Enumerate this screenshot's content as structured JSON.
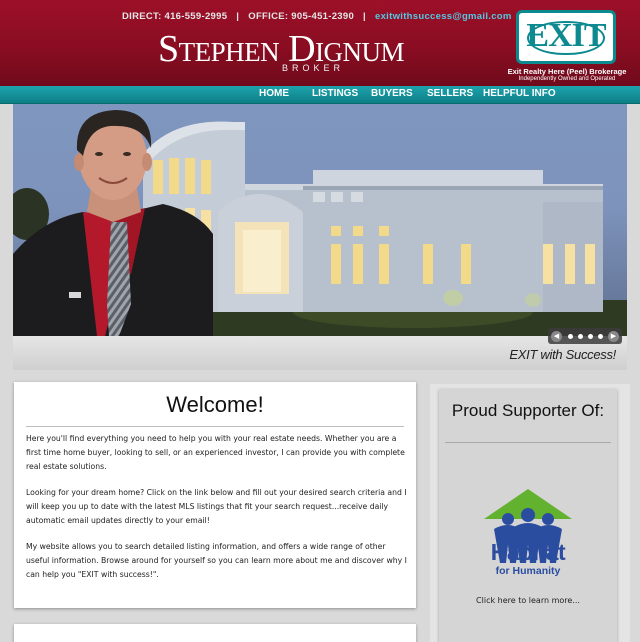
{
  "header": {
    "contact": {
      "direct": "DIRECT: 416-559-2995",
      "separator": "|",
      "office": "OFFICE: 905-451-2390",
      "email": "exitwithsuccess@gmail.com"
    },
    "name": "Stephen Dignum",
    "role": "BROKER",
    "logo": {
      "word": "EXIT",
      "brokerage": "Exit Realty Here (Peel) Brokerage",
      "tagline": "Independently Owned and Operated"
    }
  },
  "nav": {
    "items": [
      "HOME",
      "LISTINGS",
      "BUYERS",
      "SELLERS",
      "HELPFUL INFO"
    ]
  },
  "hero": {
    "tagline": "EXIT with Success!",
    "slider_prev": "◀",
    "slider_next": "▶"
  },
  "welcome": {
    "title": "Welcome!",
    "paragraphs": [
      "Here you'll find everything you need to help you with your real estate needs. Whether you are a first time home buyer, looking to sell, or an experienced investor, I can provide you with complete real estate solutions.",
      "Looking for your dream home?  Click on the link below and fill out your desired search criteria and I will keep you up to date with the latest MLS listings that fit your search request...receive daily automatic email updates directly to your email!",
      "My website allows you to search detailed listing information, and offers a wide range of other useful information. Browse around for yourself so you can learn more about me and discover why I can help you \"EXIT with success!\"."
    ]
  },
  "supporter": {
    "title": "Proud Supporter Of:",
    "org_name": "Habitat",
    "org_sub": "for Humanity",
    "learn_more": "Click here to learn more..."
  },
  "colors": {
    "header_red": "#8a0d22",
    "nav_teal": "#11929b",
    "email_blue": "#53c8e4",
    "habitat_blue": "#2a4da0",
    "habitat_green": "#62b22f"
  }
}
